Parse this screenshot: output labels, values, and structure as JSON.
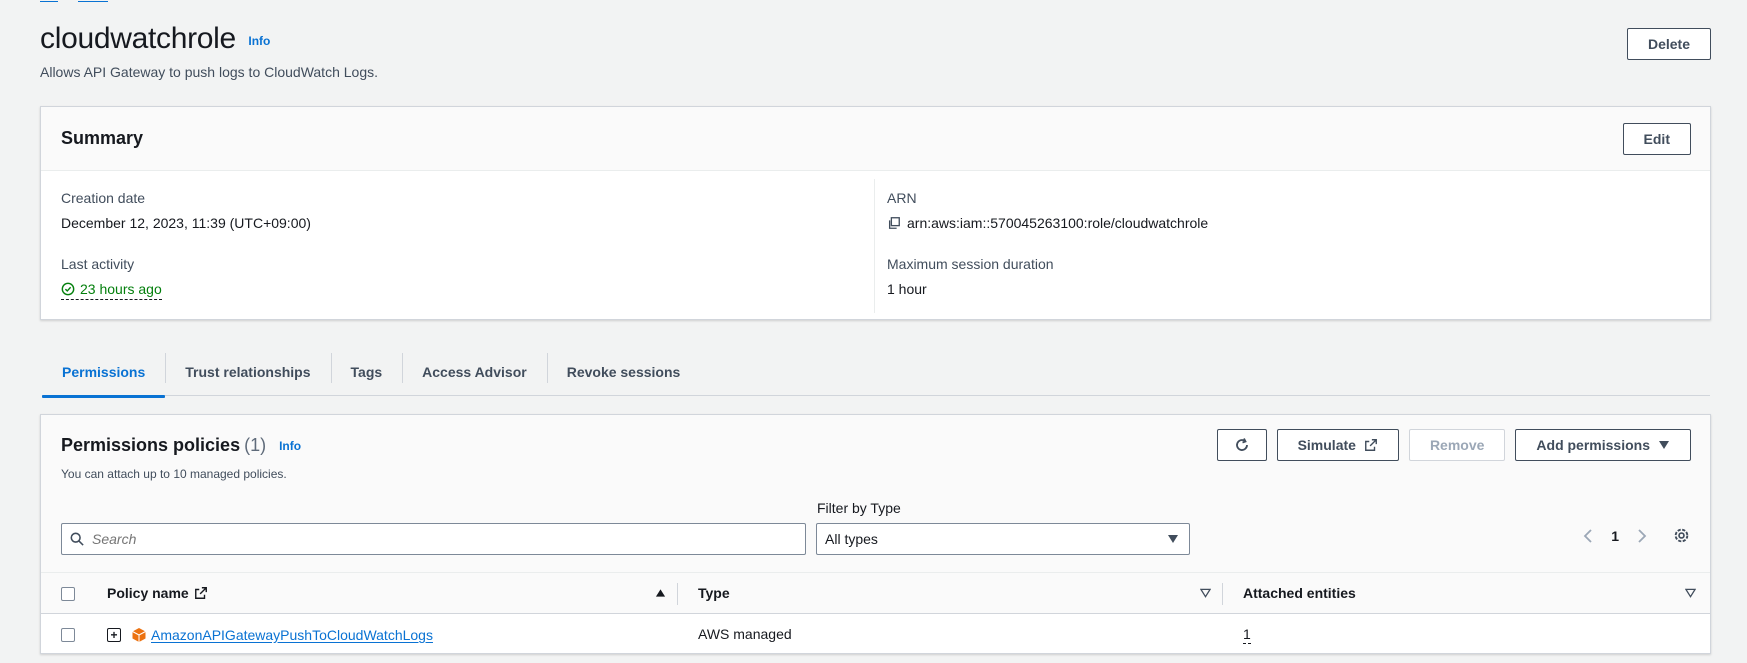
{
  "role": {
    "title": "cloudwatchrole",
    "info_label": "Info",
    "description": "Allows API Gateway to push logs to CloudWatch Logs.",
    "delete_label": "Delete"
  },
  "summary": {
    "heading": "Summary",
    "edit_label": "Edit",
    "creation_date_label": "Creation date",
    "creation_date_value": "December 12, 2023, 11:39 (UTC+09:00)",
    "last_activity_label": "Last activity",
    "last_activity_value": "23 hours ago",
    "arn_label": "ARN",
    "arn_value": "arn:aws:iam::570045263100:role/cloudwatchrole",
    "max_session_label": "Maximum session duration",
    "max_session_value": "1 hour"
  },
  "tabs": [
    {
      "label": "Permissions",
      "active": true
    },
    {
      "label": "Trust relationships",
      "active": false
    },
    {
      "label": "Tags",
      "active": false
    },
    {
      "label": "Access Advisor",
      "active": false
    },
    {
      "label": "Revoke sessions",
      "active": false
    }
  ],
  "permissions": {
    "title": "Permissions policies",
    "count": "(1)",
    "info_label": "Info",
    "description": "You can attach up to 10 managed policies.",
    "simulate_label": "Simulate",
    "remove_label": "Remove",
    "add_label": "Add permissions",
    "filter_label": "Filter by Type",
    "search_placeholder": "Search",
    "filter_value": "All types",
    "page_number": "1",
    "columns": {
      "policy_name": "Policy name",
      "type": "Type",
      "attached": "Attached entities"
    },
    "rows": [
      {
        "policy_name": "AmazonAPIGatewayPushToCloudWatchLogs",
        "type": "AWS managed",
        "attached": "1"
      }
    ]
  },
  "colors": {
    "link": "#0972d3",
    "success": "#037f0c",
    "policy_icon": "#ec7211"
  }
}
